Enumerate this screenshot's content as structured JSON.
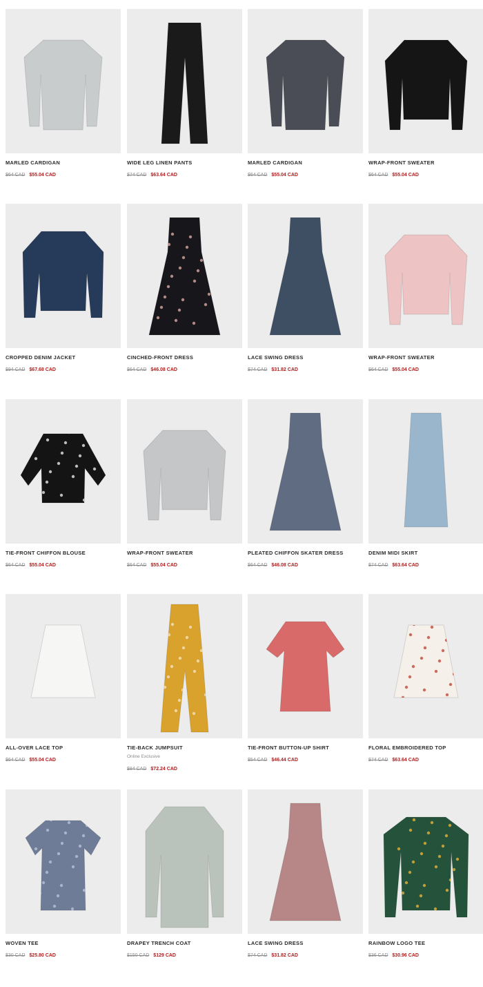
{
  "products": [
    {
      "name": "MARLED CARDIGAN",
      "was": "$64 CAD",
      "now": "$55.04 CAD",
      "image": "cardigan-light"
    },
    {
      "name": "WIDE LEG LINEN PANTS",
      "was": "$74 CAD",
      "now": "$63.64 CAD",
      "image": "pants-black"
    },
    {
      "name": "MARLED CARDIGAN",
      "was": "$64 CAD",
      "now": "$55.04 CAD",
      "image": "cardigan-dark"
    },
    {
      "name": "WRAP-FRONT SWEATER",
      "was": "$64 CAD",
      "now": "$55.04 CAD",
      "image": "sweater-black"
    },
    {
      "name": "CROPPED DENIM JACKET",
      "was": "$94 CAD",
      "now": "$67.68 CAD",
      "image": "denim-jacket"
    },
    {
      "name": "CINCHED-FRONT DRESS",
      "was": "$64 CAD",
      "now": "$46.08 CAD",
      "image": "dress-black-floral"
    },
    {
      "name": "LACE SWING DRESS",
      "was": "$74 CAD",
      "now": "$31.82 CAD",
      "image": "dress-navy"
    },
    {
      "name": "WRAP-FRONT SWEATER",
      "was": "$64 CAD",
      "now": "$55.04 CAD",
      "image": "sweater-pink"
    },
    {
      "name": "TIE-FRONT CHIFFON BLOUSE",
      "was": "$64 CAD",
      "now": "$55.04 CAD",
      "image": "blouse-black-dot"
    },
    {
      "name": "WRAP-FRONT SWEATER",
      "was": "$64 CAD",
      "now": "$55.04 CAD",
      "image": "sweater-grey"
    },
    {
      "name": "PLEATED CHIFFON SKATER DRESS",
      "was": "$64 CAD",
      "now": "$46.08 CAD",
      "image": "dress-slate"
    },
    {
      "name": "DENIM MIDI SKIRT",
      "was": "$74 CAD",
      "now": "$63.64 CAD",
      "image": "skirt-denim"
    },
    {
      "name": "ALL-OVER LACE TOP",
      "was": "$64 CAD",
      "now": "$55.04 CAD",
      "image": "top-white-lace"
    },
    {
      "name": "TIE-BACK JUMPSUIT",
      "tag": "Online Exclusive",
      "was": "$84 CAD",
      "now": "$72.24 CAD",
      "image": "jumpsuit-yellow"
    },
    {
      "name": "TIE-FRONT BUTTON-UP SHIRT",
      "was": "$54 CAD",
      "now": "$46.44 CAD",
      "image": "shirt-red-stripe"
    },
    {
      "name": "FLORAL EMBROIDERED TOP",
      "was": "$74 CAD",
      "now": "$63.64 CAD",
      "image": "top-embroidered"
    },
    {
      "name": "WOVEN TEE",
      "was": "$30 CAD",
      "now": "$25.80 CAD",
      "image": "tee-blue-print"
    },
    {
      "name": "DRAPEY TRENCH COAT",
      "was": "$150 CAD",
      "now": "$129 CAD",
      "image": "trench-sage"
    },
    {
      "name": "LACE SWING DRESS",
      "was": "$74 CAD",
      "now": "$31.82 CAD",
      "image": "dress-mauve"
    },
    {
      "name": "RAINBOW LOGO TEE",
      "was": "$36 CAD",
      "now": "$30.96 CAD",
      "image": "tee-green-logo"
    }
  ]
}
